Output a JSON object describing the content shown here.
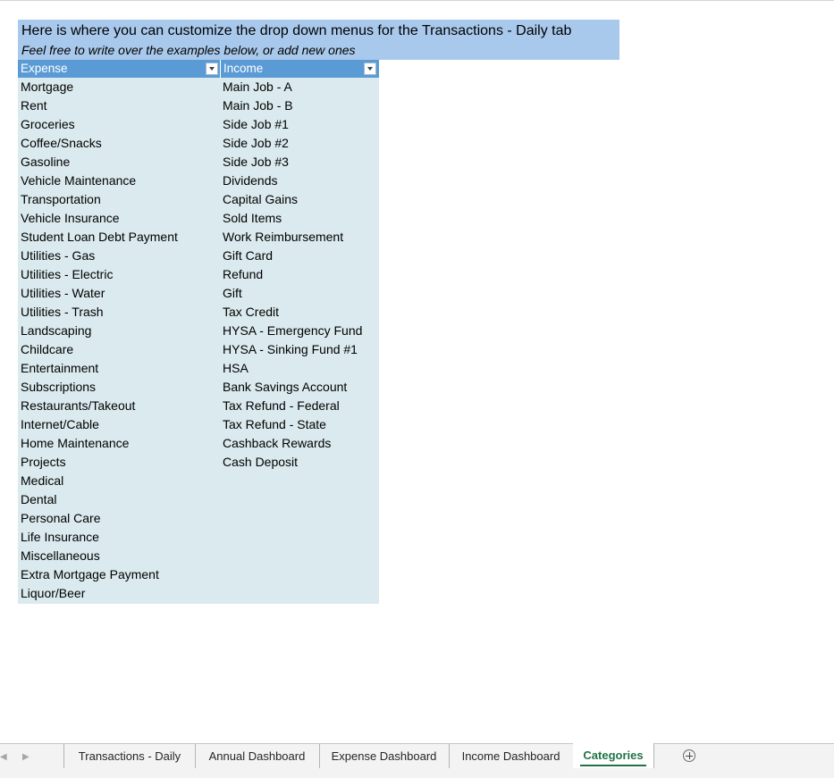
{
  "banner": {
    "title": "Here is where you can customize the drop down menus for the Transactions - Daily tab",
    "subtitle": "Feel free to write over the examples below, or add new ones"
  },
  "table": {
    "headers": {
      "expense": "Expense",
      "income": "Income"
    },
    "expense": [
      "Mortgage",
      "Rent",
      "Groceries",
      "Coffee/Snacks",
      "Gasoline",
      "Vehicle Maintenance",
      "Transportation",
      "Vehicle Insurance",
      "Student Loan Debt Payment",
      "Utilities - Gas",
      "Utilities - Electric",
      "Utilities - Water",
      "Utilities - Trash",
      "Landscaping",
      "Childcare",
      "Entertainment",
      "Subscriptions",
      "Restaurants/Takeout",
      "Internet/Cable",
      "Home Maintenance",
      "Projects",
      "Medical",
      "Dental",
      "Personal Care",
      "Life Insurance",
      "Miscellaneous",
      "Extra Mortgage Payment",
      "Liquor/Beer"
    ],
    "income": [
      "Main Job - A",
      "Main Job - B",
      "Side Job #1",
      "Side Job #2",
      "Side Job #3",
      "Dividends",
      "Capital Gains",
      "Sold Items",
      "Work Reimbursement",
      "Gift Card",
      "Refund",
      "Gift",
      "Tax Credit",
      "HYSA - Emergency Fund",
      "HYSA - Sinking Fund #1",
      "HSA",
      "Bank Savings Account",
      "Tax Refund - Federal",
      "Tax Refund - State",
      "Cashback Rewards",
      "Cash Deposit"
    ]
  },
  "tabs": [
    {
      "label": "Transactions - Daily",
      "active": false
    },
    {
      "label": "Annual Dashboard",
      "active": false
    },
    {
      "label": "Expense Dashboard",
      "active": false
    },
    {
      "label": "Income Dashboard",
      "active": false
    },
    {
      "label": "Categories",
      "active": true
    }
  ],
  "colors": {
    "banner_bg": "#a9c9ec",
    "header_bg": "#5b9bd5",
    "table_bg": "#daeaee",
    "active_tab": "#217346"
  }
}
